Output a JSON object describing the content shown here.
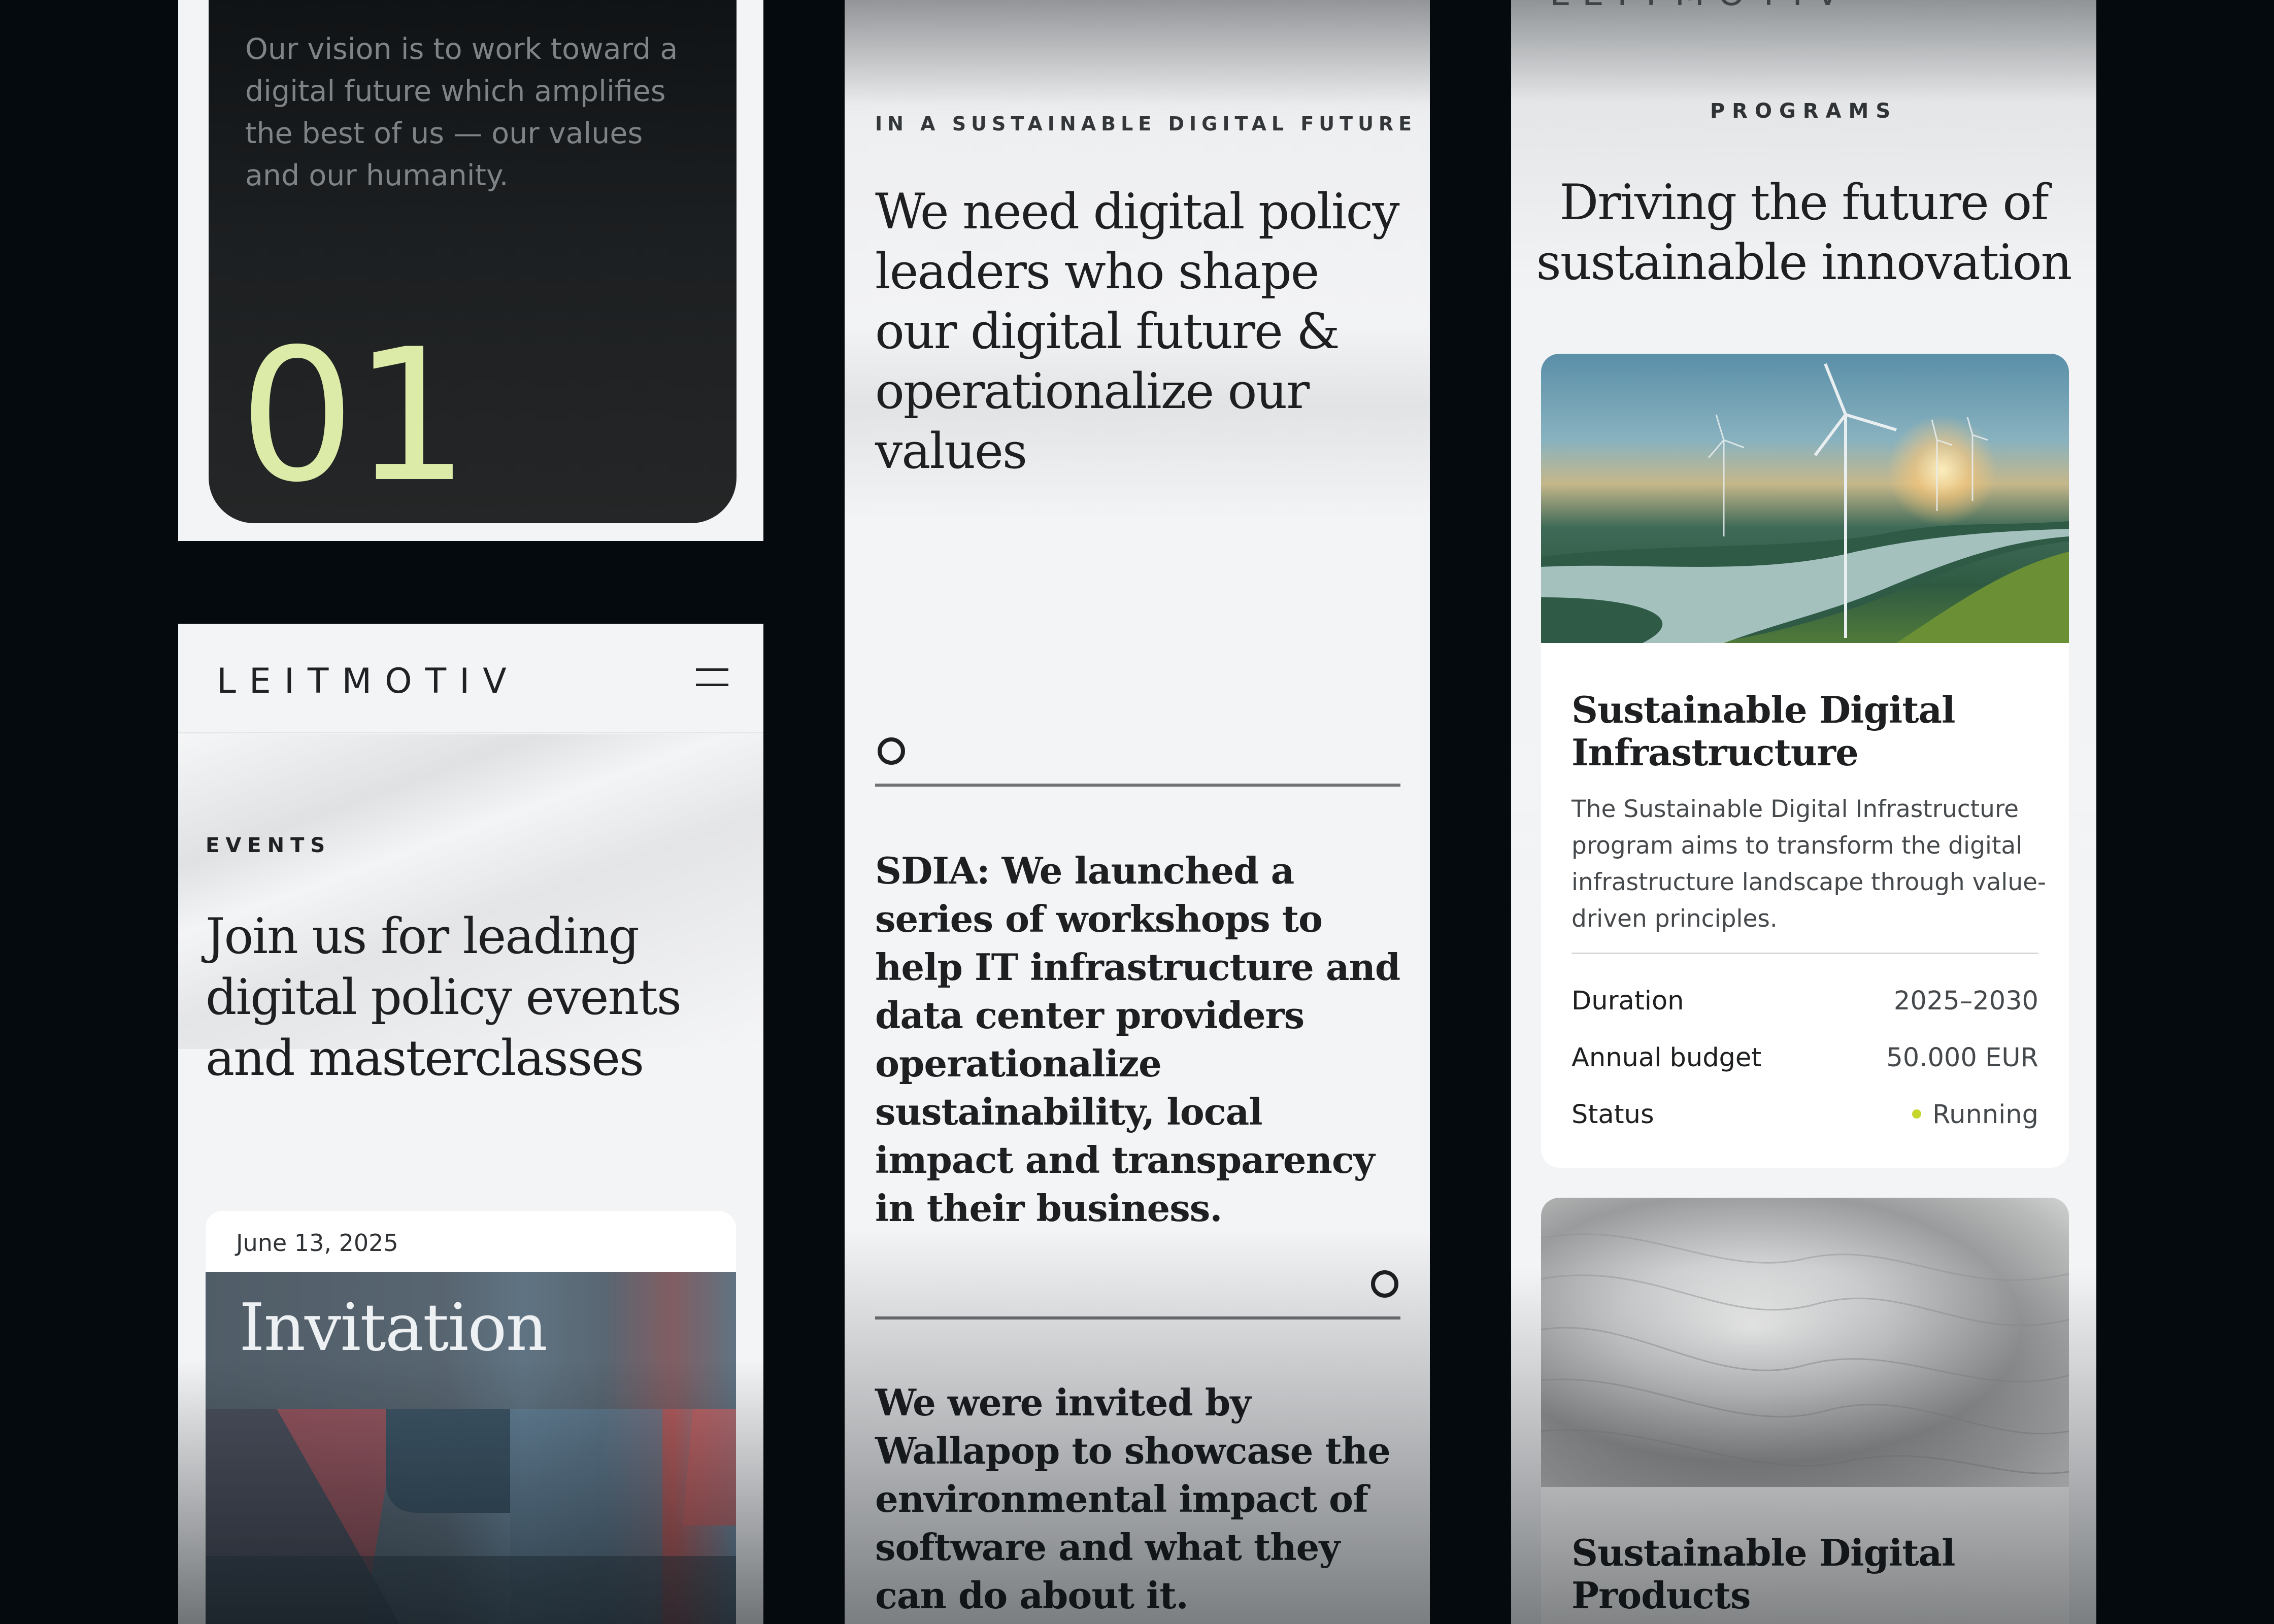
{
  "colors": {
    "page_background": "#050a0e",
    "surface": "#f3f4f6",
    "dark_card": "#1c1f21",
    "accent_lime": "#dceba7",
    "status_running": "#c7d62c",
    "text_primary": "#1d1f21"
  },
  "vision_card": {
    "text": "Our vision is to work toward a digital future which amplifies the best of us — our values and our humanity.",
    "number": "01"
  },
  "events_screen": {
    "logo": "LEITMOTIV",
    "menu_icon": "hamburger-menu-icon",
    "eyebrow": "EVENTS",
    "heading": "Join us for leading digital policy events and masterclasses",
    "event_card": {
      "date": "June 13, 2025",
      "image_title": "Invitation"
    }
  },
  "news_screen": {
    "eyebrow": "IN A SUSTAINABLE DIGITAL FUTURE",
    "heading": "We need digital policy leaders who shape our digital future & operationalize our values",
    "items": [
      {
        "icon": "clock-icon",
        "text": "SDIA: We launched a series of workshops to help IT infrastructure and data center providers operationalize sustainability, local impact and transparency in their business."
      },
      {
        "icon": "clock-icon",
        "text": "We were invited by Wallapop to showcase the environmental impact of software and what they can do about it."
      }
    ]
  },
  "programs_screen": {
    "logo": "LEITMOTIV",
    "eyebrow": "PROGRAMS",
    "heading": "Driving the future of sustainable innovation",
    "programs": [
      {
        "title": "Sustainable Digital Infrastructure",
        "description": "The Sustainable Digital Infrastructure program aims to transform the digital infrastructure landscape through value-driven principles.",
        "meta": [
          {
            "label": "Duration",
            "value": "2025–2030"
          },
          {
            "label": "Annual budget",
            "value": "50.000 EUR"
          },
          {
            "label": "Status",
            "value": "Running"
          }
        ]
      },
      {
        "title": "Sustainable Digital Products"
      }
    ]
  }
}
